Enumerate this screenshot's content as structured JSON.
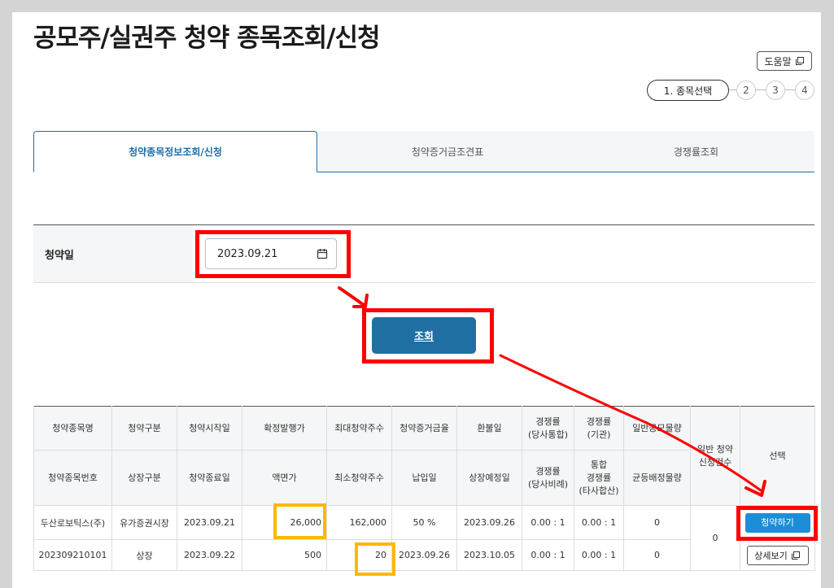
{
  "page": {
    "title": "공모주/실권주 청약 종목조회/신청"
  },
  "help": {
    "label": "도움말"
  },
  "steps": {
    "active_label": "1. 종목선택",
    "others": [
      "2",
      "3",
      "4"
    ]
  },
  "tabs": [
    {
      "label": "청약종목정보조회/신청",
      "active": true
    },
    {
      "label": "청약증거금조견표",
      "active": false
    },
    {
      "label": "경쟁률조회",
      "active": false
    }
  ],
  "form": {
    "date_label": "청약일",
    "date_value": "2023.09.21"
  },
  "search": {
    "label": "조회"
  },
  "table": {
    "header_row1": [
      "청약종목명",
      "청약구분",
      "청약시작일",
      "확정발행가",
      "최대청약주수",
      "청약증거금율",
      "환불일",
      "경쟁률\n(당사통합)",
      "경쟁률\n(기관)",
      "일반공모물량",
      "일반 청약\n신청건수",
      "선택"
    ],
    "header_row2": [
      "청약종목번호",
      "상장구분",
      "청약종료일",
      "액면가",
      "최소청약주수",
      "납입일",
      "상장예정일",
      "경쟁률\n(당사비례)",
      "통합\n경쟁률\n(타사합산)",
      "균등배정물량"
    ],
    "row1": [
      "두산로보틱스(주)",
      "유가증권시장",
      "2023.09.21",
      "26,000",
      "162,000",
      "50 %",
      "2023.09.26",
      "0.00 : 1",
      "0.00 : 1",
      "0"
    ],
    "row2": [
      "202309210101",
      "상장",
      "2023.09.22",
      "500",
      "20",
      "2023.09.26",
      "2023.10.05",
      "0.00 : 1",
      "0.00 : 1",
      "0"
    ],
    "apply_count": "0",
    "subscribe_label": "청약하기",
    "detail_label": "상세보기"
  },
  "colors": {
    "accent": "#1f6fa3",
    "highlight_red": "#ff0000",
    "highlight_yellow": "#ffb800"
  }
}
